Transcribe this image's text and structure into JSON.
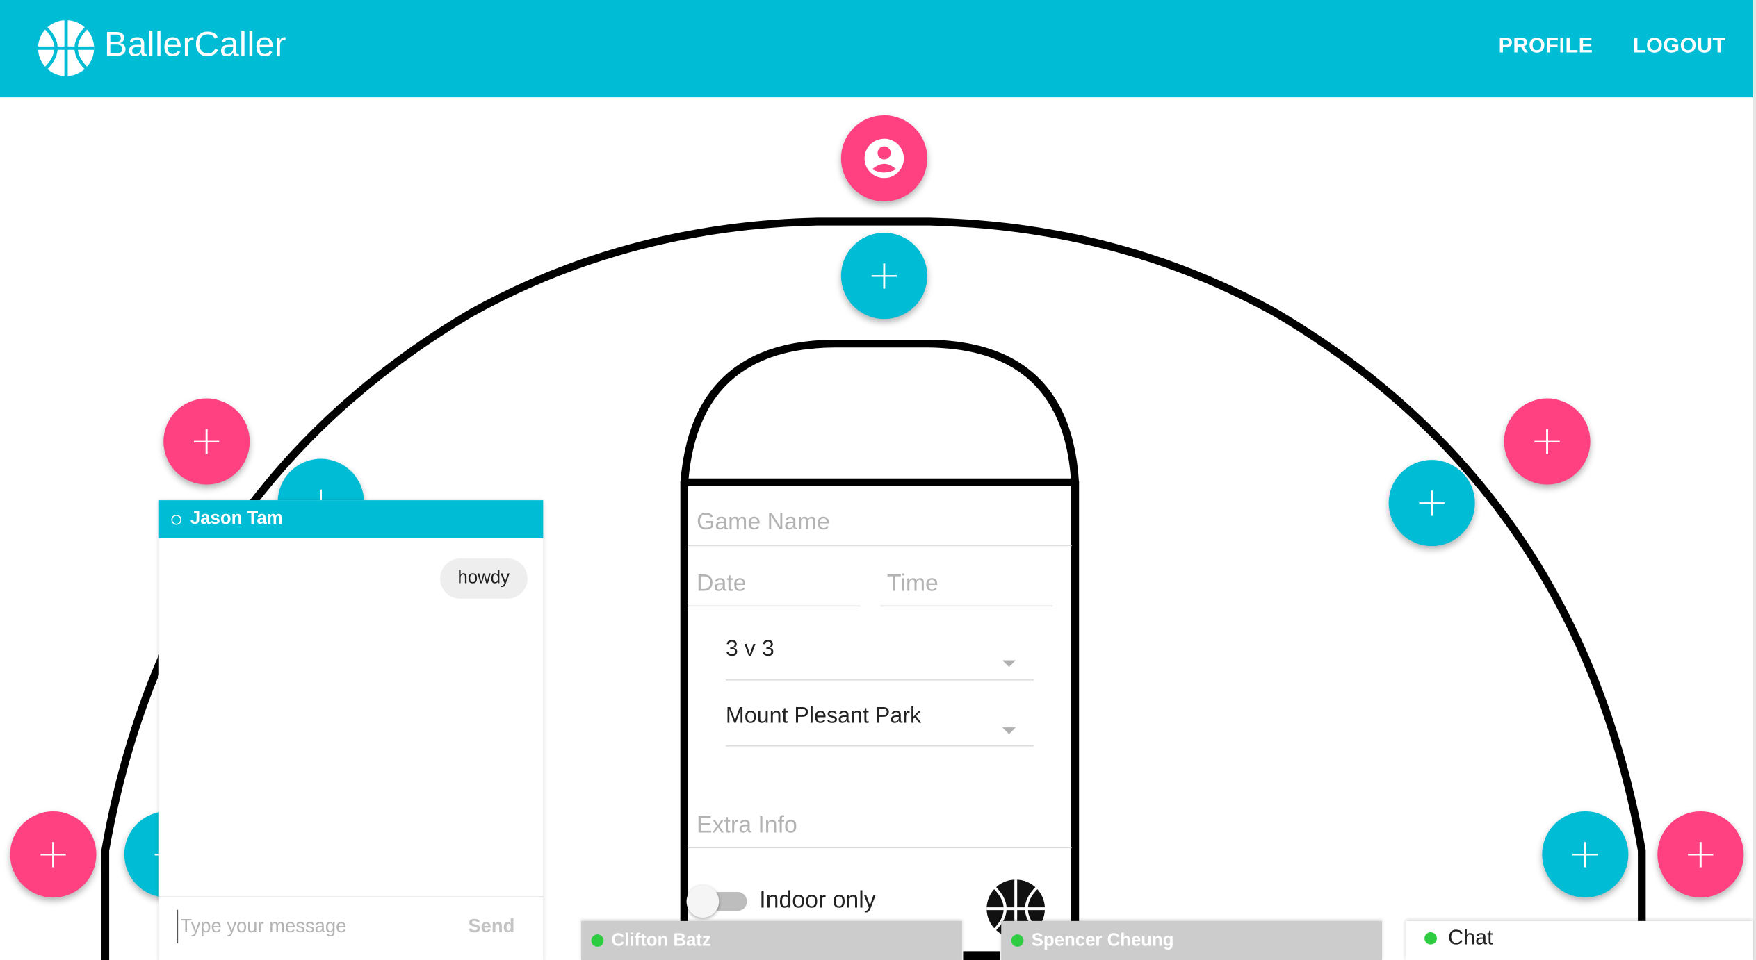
{
  "app": {
    "brand_name": "BallerCaller",
    "nav": {
      "profile": "PROFILE",
      "logout": "LOGOUT"
    }
  },
  "colors": {
    "primary": "#00bcd4",
    "accent": "#ff4081",
    "online": "#2ecc40"
  },
  "court": {
    "top_player_icon": "account-circle-icon",
    "slot_button_label": "+"
  },
  "chat_window": {
    "contact_name": "Jason Tam",
    "messages": [
      {
        "text": "howdy",
        "from": "self"
      }
    ],
    "input_placeholder": "Type your message",
    "send_label": "Send"
  },
  "game_form": {
    "game_name_placeholder": "Game Name",
    "date_placeholder": "Date",
    "time_placeholder": "Time",
    "game_type_value": "3 v 3",
    "location_value": "Mount Plesant Park",
    "extra_info_placeholder": "Extra Info",
    "indoor_toggle_label": "Indoor only",
    "indoor_toggle_on": false
  },
  "chat_tabs": [
    {
      "name": "Clifton Batz"
    },
    {
      "name": "Spencer Cheung"
    }
  ],
  "chat_launcher": {
    "label": "Chat"
  }
}
